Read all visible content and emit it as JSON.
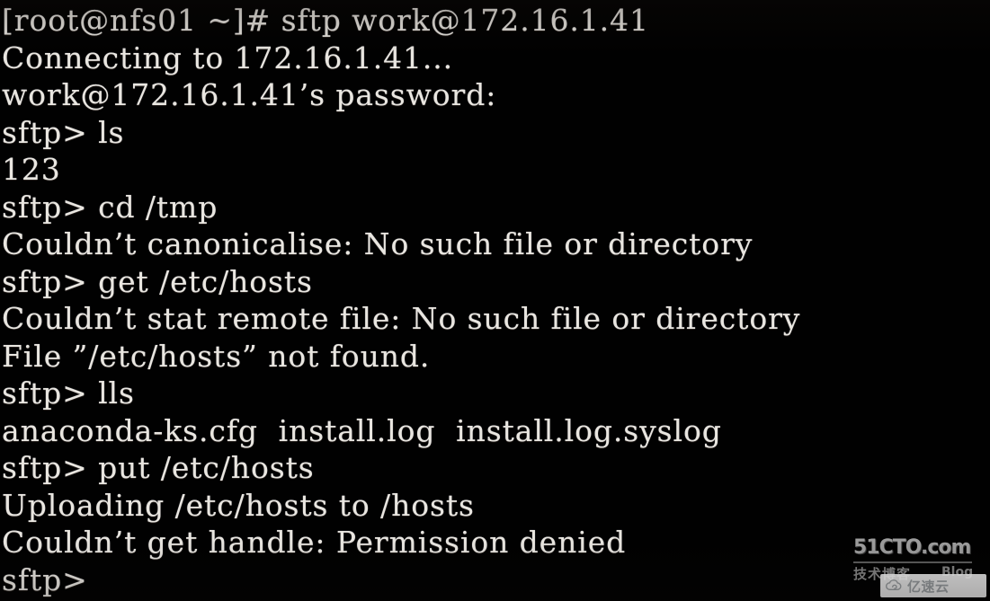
{
  "terminal": {
    "background_color": "#010101",
    "text_color": "#e9e6e0",
    "prompt_host": "[root@nfs01 ~]#",
    "sftp_prompt": "sftp>",
    "lines": [
      "[root@nfs01 ~]# sftp work@172.16.1.41",
      "Connecting to 172.16.1.41...",
      "work@172.16.1.41’s password:",
      "sftp> ls",
      "123",
      "sftp> cd /tmp",
      "Couldn’t canonicalise: No such file or directory",
      "sftp> get /etc/hosts",
      "Couldn’t stat remote file: No such file or directory",
      "File ”/etc/hosts” not found.",
      "sftp> lls",
      "anaconda-ks.cfg  install.log  install.log.syslog",
      "sftp> put /etc/hosts",
      "Uploading /etc/hosts to /hosts",
      "Couldn’t get handle: Permission denied",
      "sftp>"
    ]
  },
  "watermark": {
    "brand": "51CTO.com",
    "subtitle": "技术博客",
    "blog_label": "Blog",
    "overlay_text": "亿速云",
    "overlay_icon": "cloud-icon"
  }
}
